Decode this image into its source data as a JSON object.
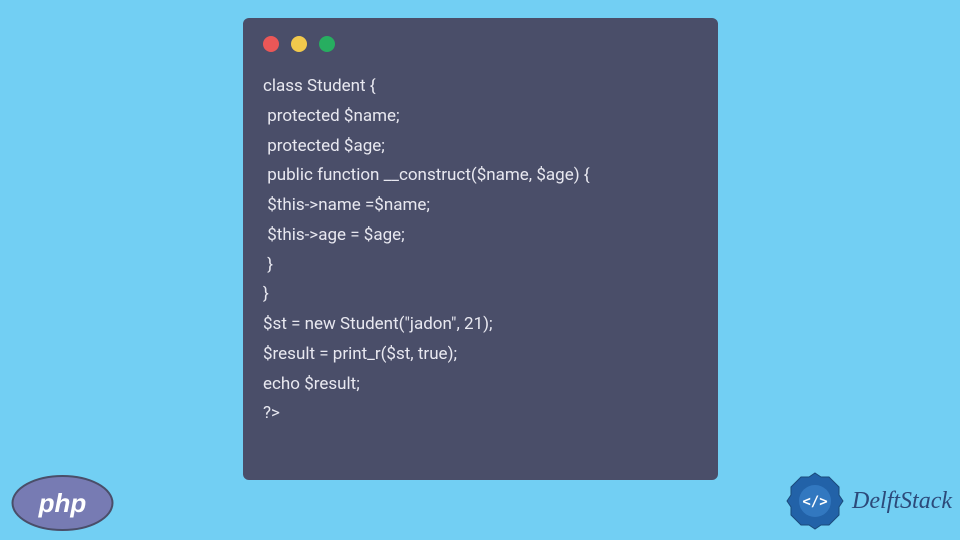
{
  "code": {
    "lines": [
      "class Student {",
      " protected $name;",
      " protected $age;",
      " public function __construct($name, $age) {",
      " $this->name =$name;",
      " $this->age = $age;",
      " }",
      "}",
      "$st = new Student(\"jadon\", 21);",
      "$result = print_r($st, true);",
      "echo $result;",
      "?>"
    ]
  },
  "branding": {
    "delft_text": "DelftStack",
    "php_label": "php"
  },
  "colors": {
    "background": "#72cff3",
    "window_bg": "#4a4e69",
    "code_text": "#e8e8f0",
    "php_purple": "#777bb3",
    "delft_blue": "#2c4a7a"
  }
}
